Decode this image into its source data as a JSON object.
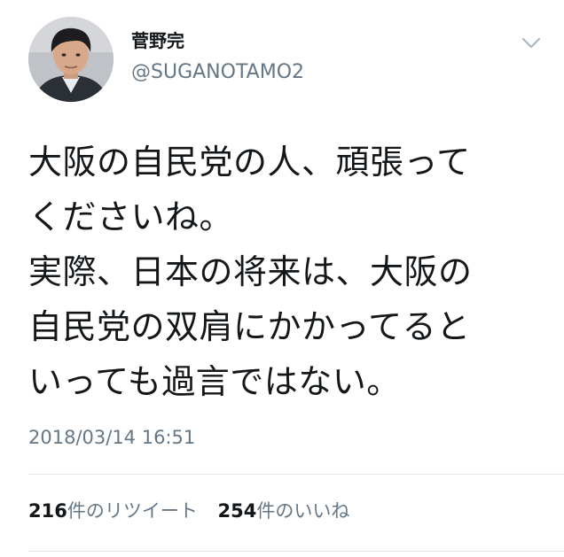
{
  "user": {
    "display_name": "菅野完",
    "handle": "@SUGANOTAMO2",
    "avatar_icon": "user-avatar"
  },
  "menu": {
    "icon": "chevron-down-icon"
  },
  "tweet": {
    "lines": [
      "大阪の自民党の人、頑張って",
      "くださいね。",
      "実際、日本の将来は、大阪の",
      "自民党の双肩にかかってると",
      "いっても過言ではない。"
    ],
    "timestamp": "2018/03/14 16:51"
  },
  "stats": {
    "retweets": {
      "count": "216",
      "label": "件のリツイート"
    },
    "likes": {
      "count": "254",
      "label": "件のいいね"
    }
  },
  "colors": {
    "text": "#14171a",
    "secondary": "#657786",
    "divider": "#e1e8ed"
  }
}
